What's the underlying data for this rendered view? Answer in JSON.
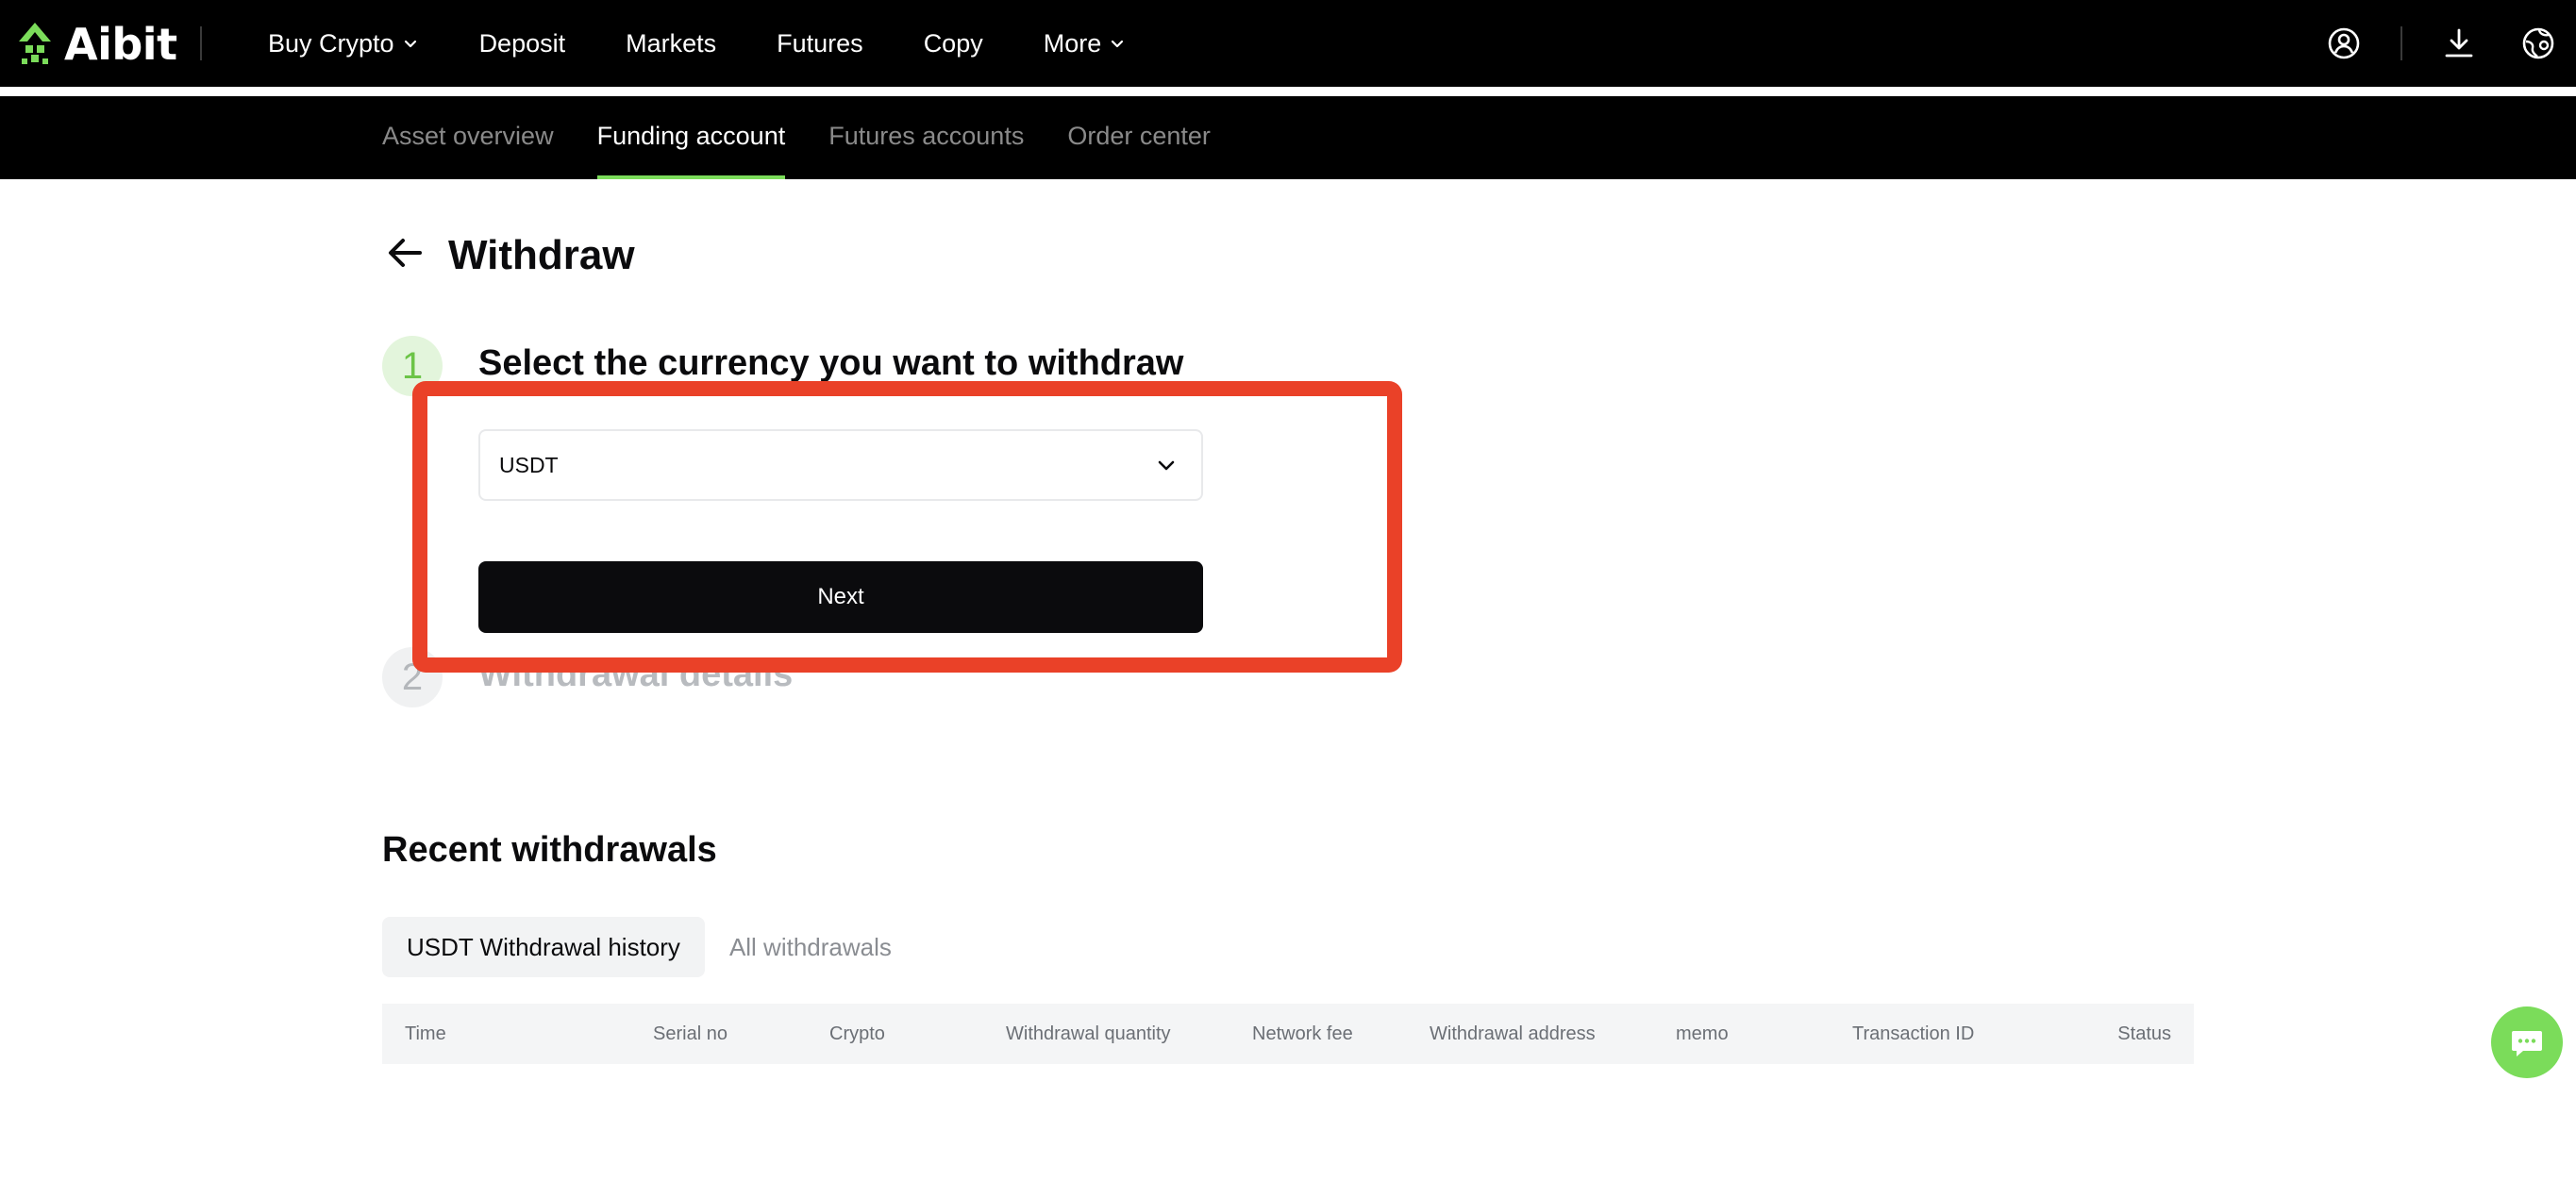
{
  "brand": {
    "name": "Aibit",
    "accent": "#7bdc5a",
    "highlight": "#ea4128"
  },
  "topnav": {
    "items": [
      {
        "label": "Buy Crypto",
        "dropdown": true
      },
      {
        "label": "Deposit",
        "dropdown": false
      },
      {
        "label": "Markets",
        "dropdown": false
      },
      {
        "label": "Futures",
        "dropdown": false
      },
      {
        "label": "Copy",
        "dropdown": false
      },
      {
        "label": "More",
        "dropdown": true
      }
    ],
    "icons": [
      "user-icon",
      "download-icon",
      "globe-icon"
    ]
  },
  "subnav": {
    "tabs": [
      "Asset overview",
      "Funding account",
      "Futures accounts",
      "Order center"
    ],
    "active": "Funding account"
  },
  "page": {
    "title": "Withdraw"
  },
  "step1": {
    "number": "1",
    "title": "Select the currency you want to withdraw",
    "selected_currency": "USDT",
    "next_label": "Next"
  },
  "step2": {
    "number": "2",
    "title": "Withdrawal details"
  },
  "recent": {
    "title": "Recent withdrawals",
    "tabs": [
      "USDT Withdrawal history",
      "All withdrawals"
    ],
    "columns": [
      "Time",
      "Serial no",
      "Crypto",
      "Withdrawal quantity",
      "Network fee",
      "Withdrawal address",
      "memo",
      "Transaction ID",
      "Status"
    ]
  }
}
